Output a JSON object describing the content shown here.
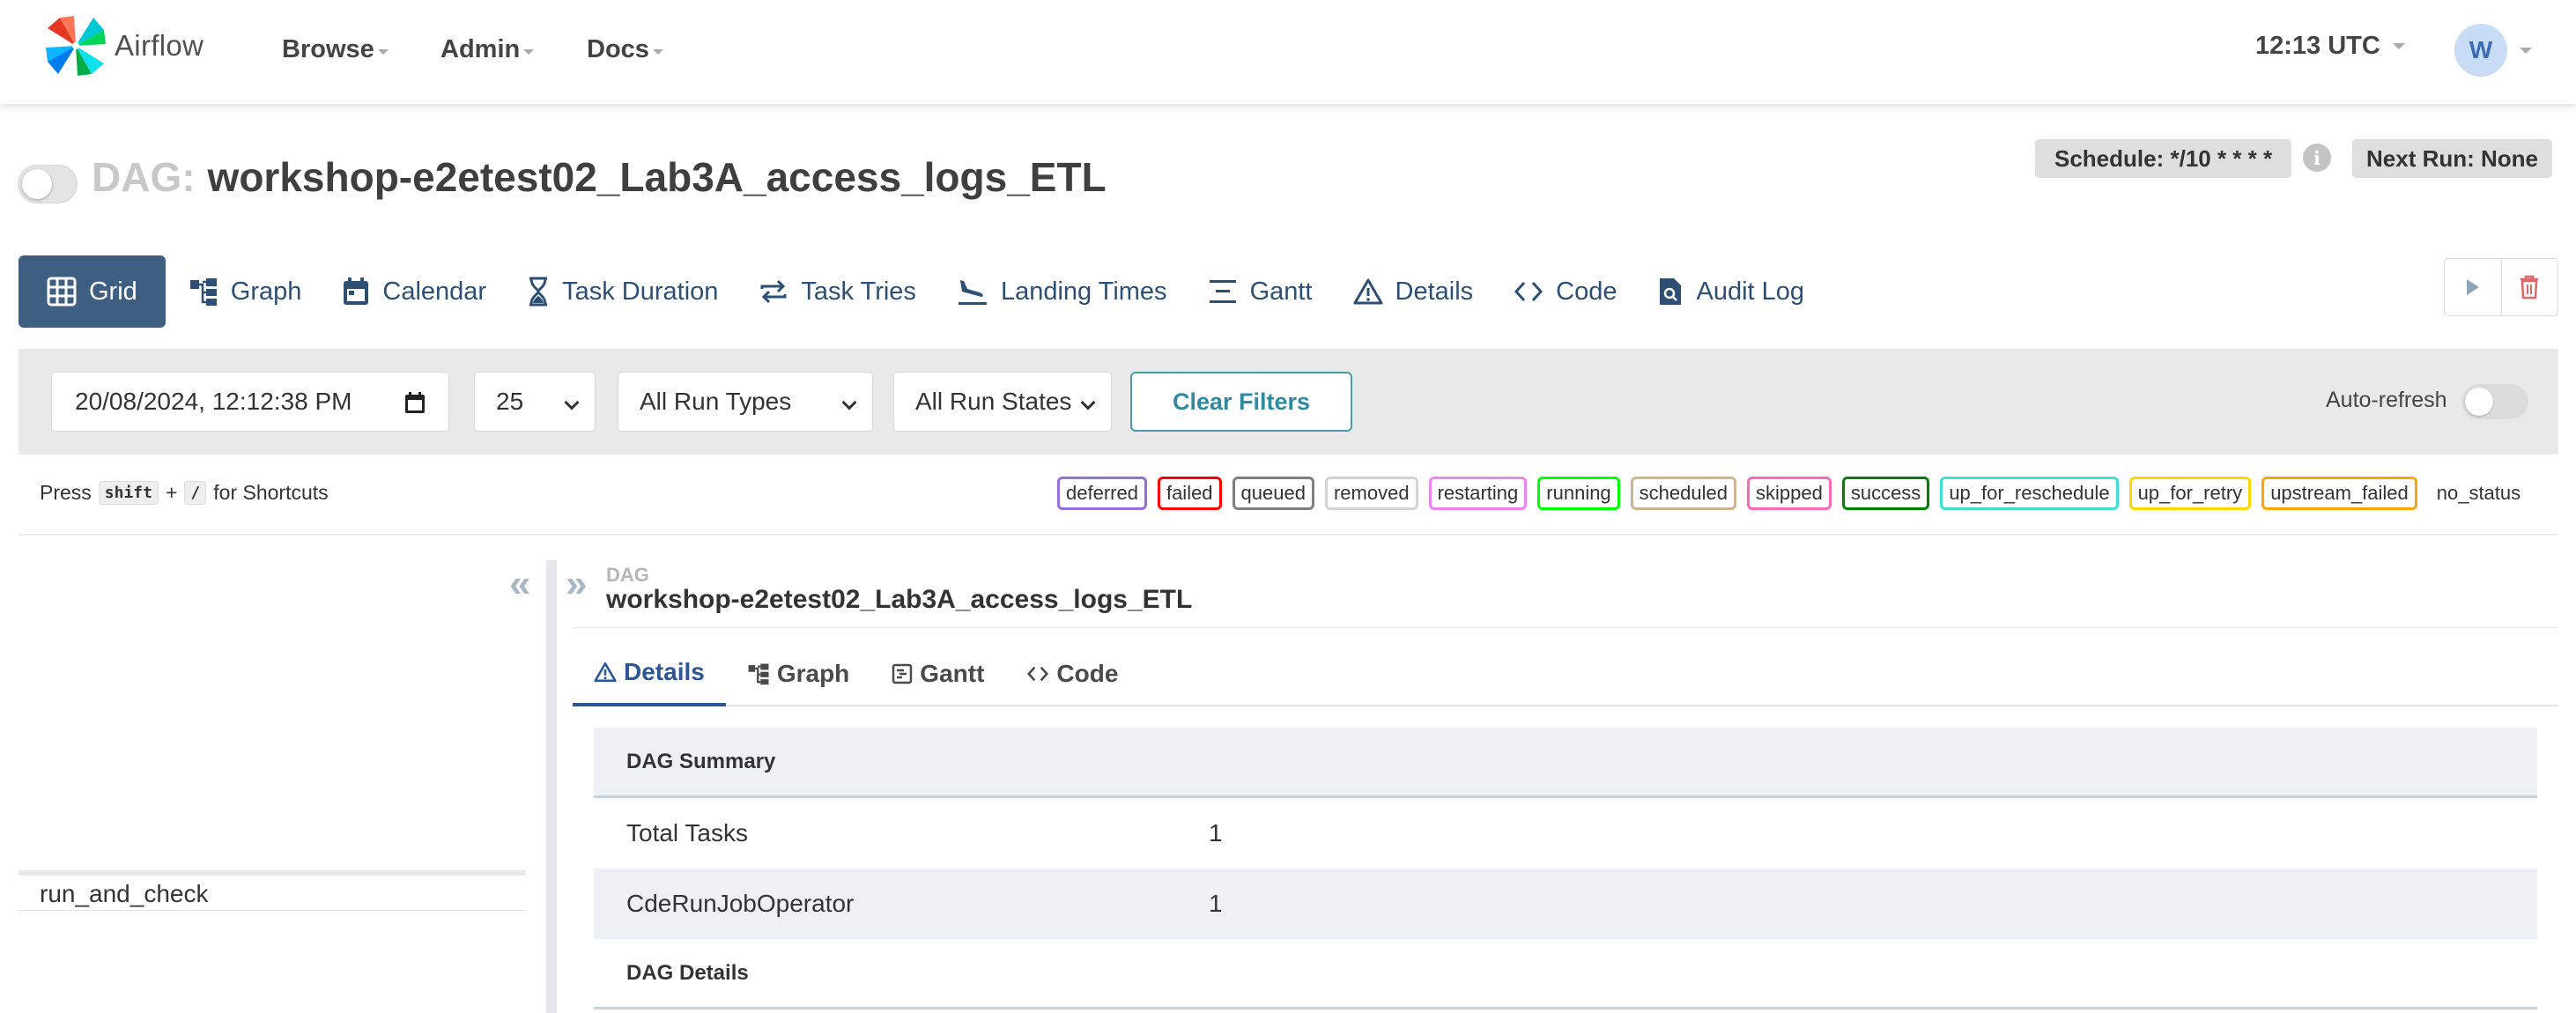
{
  "app": {
    "name": "Airflow"
  },
  "nav": {
    "menus": [
      {
        "label": "Browse"
      },
      {
        "label": "Admin"
      },
      {
        "label": "Docs"
      }
    ],
    "time": "12:13 UTC",
    "user_initial": "W"
  },
  "dag": {
    "prefix": "DAG:",
    "name": "workshop-e2etest02_Lab3A_access_logs_ETL",
    "schedule": "Schedule: */10 * * * *",
    "next_run": "Next Run: None",
    "paused": true
  },
  "view_tabs": [
    {
      "label": "Grid",
      "icon": "grid-icon",
      "active": true
    },
    {
      "label": "Graph",
      "icon": "graph-icon"
    },
    {
      "label": "Calendar",
      "icon": "calendar-icon"
    },
    {
      "label": "Task Duration",
      "icon": "hourglass-icon"
    },
    {
      "label": "Task Tries",
      "icon": "retry-icon"
    },
    {
      "label": "Landing Times",
      "icon": "plane-landing-icon"
    },
    {
      "label": "Gantt",
      "icon": "gantt-icon"
    },
    {
      "label": "Details",
      "icon": "warning-triangle-icon"
    },
    {
      "label": "Code",
      "icon": "code-icon"
    },
    {
      "label": "Audit Log",
      "icon": "file-search-icon"
    }
  ],
  "actions": {
    "trigger_icon": "play-icon",
    "delete_icon": "trash-icon"
  },
  "filters": {
    "date": "20/08/2024, 12:12:38 PM",
    "num_runs": "25",
    "run_type": "All Run Types",
    "run_state": "All Run States",
    "clear_label": "Clear Filters",
    "autorefresh_label": "Auto-refresh",
    "autorefresh_on": false
  },
  "shortcuts": {
    "press": "Press",
    "key1": "shift",
    "plus": "+",
    "key2": "/",
    "suffix": "for Shortcuts"
  },
  "legend": [
    {
      "label": "deferred",
      "color": "#9370db"
    },
    {
      "label": "failed",
      "color": "#ff0000"
    },
    {
      "label": "queued",
      "color": "#808080"
    },
    {
      "label": "removed",
      "color": "#d3d3d3"
    },
    {
      "label": "restarting",
      "color": "#ee82ee"
    },
    {
      "label": "running",
      "color": "#00ff00"
    },
    {
      "label": "scheduled",
      "color": "#d2b48c"
    },
    {
      "label": "skipped",
      "color": "#ff69b4"
    },
    {
      "label": "success",
      "color": "#008000"
    },
    {
      "label": "up_for_reschedule",
      "color": "#40e0d0"
    },
    {
      "label": "up_for_retry",
      "color": "#ffd700"
    },
    {
      "label": "upstream_failed",
      "color": "#ffa500"
    }
  ],
  "no_status": "no_status",
  "grid": {
    "tasks": [
      "run_and_check"
    ]
  },
  "details": {
    "crumb_label": "DAG",
    "crumb_value": "workshop-e2etest02_Lab3A_access_logs_ETL",
    "tabs": [
      {
        "label": "Details",
        "icon": "warning-triangle-icon",
        "active": true
      },
      {
        "label": "Graph",
        "icon": "graph-icon"
      },
      {
        "label": "Gantt",
        "icon": "gantt-icon"
      },
      {
        "label": "Code",
        "icon": "code-icon"
      }
    ],
    "summary_header": "DAG Summary",
    "summary_rows": [
      {
        "key": "Total Tasks",
        "value": "1"
      },
      {
        "key": "CdeRunJobOperator",
        "value": "1"
      }
    ],
    "details_header": "DAG Details"
  }
}
